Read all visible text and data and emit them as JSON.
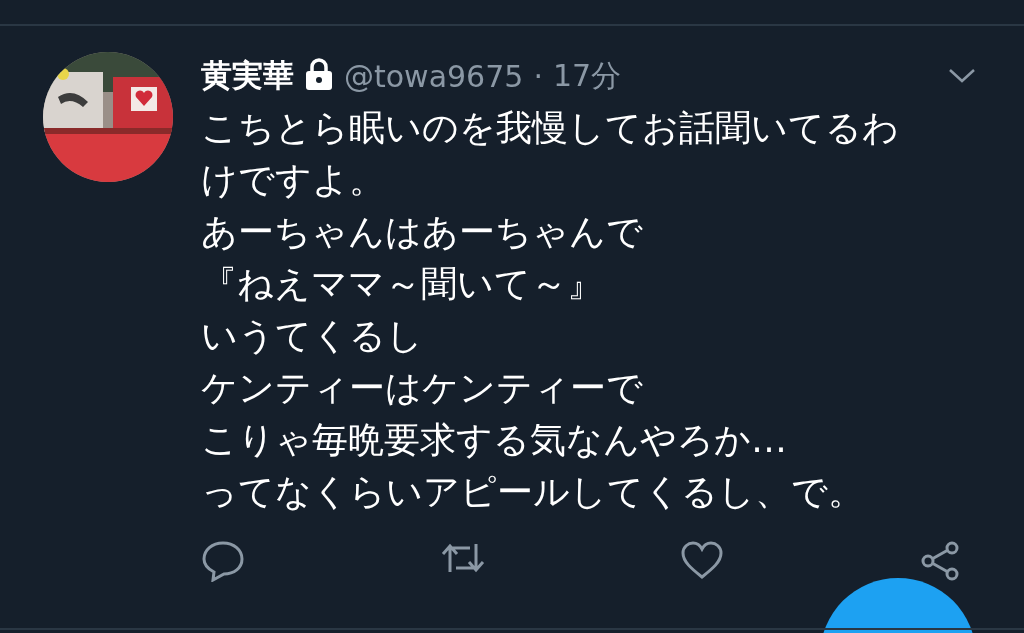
{
  "tweet": {
    "name": "黄実華",
    "protected": true,
    "handle": "@towa9675",
    "separator": "·",
    "time": "17分",
    "lines": [
      "こちとら眠いのを我慢してお話聞いてるわ",
      "けですよ。",
      "あーちゃんはあーちゃんで",
      "『ねえママ～聞いて～』",
      "いうてくるし",
      "ケンティーはケンティーで",
      "こりゃ毎晩要求する気なんやろか…",
      "ってなくらいアピールしてくるし、で。"
    ]
  }
}
